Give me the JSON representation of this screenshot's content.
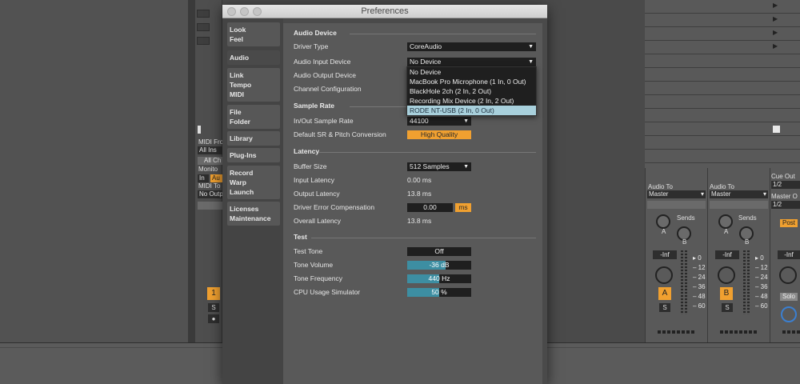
{
  "window": {
    "title": "Preferences"
  },
  "sidebar": {
    "groups": [
      {
        "lines": [
          "Look",
          "Feel"
        ]
      },
      {
        "lines": [
          "Audio"
        ]
      },
      {
        "lines": [
          "Link",
          "Tempo",
          "MIDI"
        ]
      },
      {
        "lines": [
          "File",
          "Folder"
        ]
      },
      {
        "lines": [
          "Library"
        ]
      },
      {
        "lines": [
          "Plug-Ins"
        ]
      },
      {
        "lines": [
          "Record",
          "Warp",
          "Launch"
        ]
      },
      {
        "lines": [
          "Licenses",
          "Maintenance"
        ]
      }
    ],
    "active": "Audio"
  },
  "audio_device": {
    "heading": "Audio Device",
    "driver_type_label": "Driver Type",
    "driver_type_value": "CoreAudio",
    "input_label": "Audio Input Device",
    "input_value": "No Device",
    "output_label": "Audio Output Device",
    "channel_config_label": "Channel Configuration",
    "menu_items": [
      "No Device",
      "MacBook Pro Microphone (1 In, 0 Out)",
      "BlackHole 2ch (2 In, 2 Out)",
      "Recording Mix Device (2 In, 2 Out)",
      "RODE NT-USB (2 In, 0 Out)"
    ],
    "menu_highlighted": "RODE NT-USB (2 In, 0 Out)"
  },
  "sample_rate": {
    "heading": "Sample Rate",
    "io_label": "In/Out Sample Rate",
    "io_value": "44100",
    "sr_conv_label": "Default SR & Pitch Conversion",
    "sr_conv_value": "High Quality"
  },
  "latency": {
    "heading": "Latency",
    "buffer_label": "Buffer Size",
    "buffer_value": "512 Samples",
    "input_latency_label": "Input Latency",
    "input_latency_value": "0.00 ms",
    "output_latency_label": "Output Latency",
    "output_latency_value": "13.8 ms",
    "driver_comp_label": "Driver Error Compensation",
    "driver_comp_value": "0.00",
    "driver_comp_unit": "ms",
    "overall_label": "Overall Latency",
    "overall_value": "13.8 ms"
  },
  "test": {
    "heading": "Test",
    "tone_label": "Test Tone",
    "tone_value": "Off",
    "volume_label": "Tone Volume",
    "volume_value": "-36 dB",
    "volume_level": 0.6,
    "freq_label": "Tone Frequency",
    "freq_value": "440",
    "freq_unit": "Hz",
    "freq_level": 0.5,
    "cpu_label": "CPU Usage Simulator",
    "cpu_value": "50 %",
    "cpu_level": 0.5
  },
  "background": {
    "left_panel": {
      "midi_from": "MIDI Fro",
      "all_ins": "All Ins",
      "all_ch": "All Ch",
      "monitor": "Monito",
      "mon_in": "In",
      "mon_auto": "Au",
      "midi_to": "MIDI To",
      "no_output": "No Outp",
      "track_number": "1",
      "solo": "S"
    },
    "tracks": [
      {
        "audio_to": "Audio To",
        "dest": "Master",
        "sends": "Sends",
        "knob_a": "A",
        "knob_b": "B",
        "volume": "-Inf",
        "button": "A",
        "solo": "S",
        "scale": [
          "0",
          "12",
          "24",
          "36",
          "48",
          "60"
        ]
      },
      {
        "audio_to": "Audio To",
        "dest": "Master",
        "sends": "Sends",
        "knob_a": "A",
        "knob_b": "B",
        "volume": "-Inf",
        "button": "B",
        "solo": "S",
        "scale": [
          "0",
          "12",
          "24",
          "36",
          "48",
          "60"
        ]
      }
    ],
    "master": {
      "cue_out": "Cue Out",
      "cue_val": "1/2",
      "master_out": "Master O",
      "master_val": "1/2",
      "post": "Post",
      "volume": "-Inf",
      "solo": "Solo"
    }
  }
}
